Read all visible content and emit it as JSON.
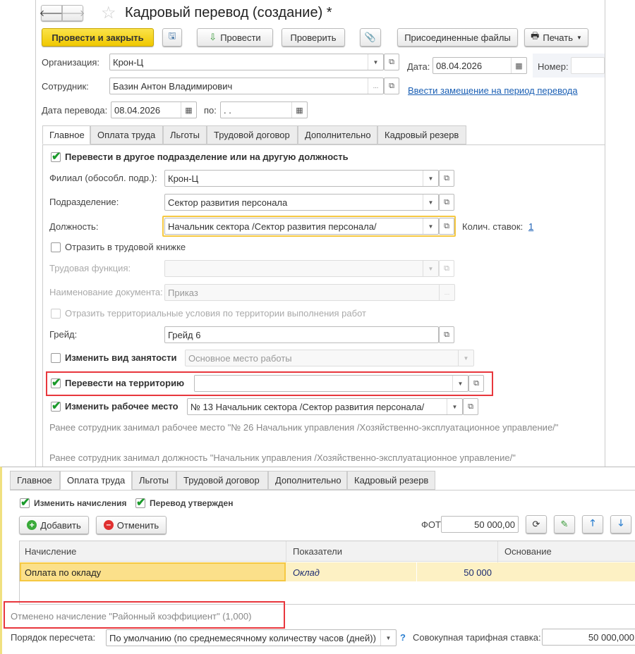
{
  "title": "Кадровый перевод (создание) *",
  "toolbar": {
    "post_close": "Провести и закрыть",
    "post": "Провести",
    "check": "Проверить",
    "files": "Присоединенные файлы",
    "print": "Печать"
  },
  "header": {
    "org_label": "Организация:",
    "org_value": "Крон-Ц",
    "date_label": "Дата:",
    "date_value": "08.04.2026",
    "number_label": "Номер:",
    "employee_label": "Сотрудник:",
    "employee_value": "Базин Антон Владимирович",
    "replacement_link": "Ввести замещение на период перевода",
    "transfer_date_label": "Дата перевода:",
    "transfer_date_value": "08.04.2026",
    "to_label": "по:",
    "to_value": " .  . "
  },
  "tabs": [
    "Главное",
    "Оплата труда",
    "Льготы",
    "Трудовой договор",
    "Дополнительно",
    "Кадровый резерв"
  ],
  "main": {
    "transfer_cb": "Перевести в другое подразделение или на другую должность",
    "branch_label": "Филиал (обособл. подр.):",
    "branch_value": "Крон-Ц",
    "dept_label": "Подразделение:",
    "dept_value": "Сектор развития персонала",
    "position_label": "Должность:",
    "position_value": "Начальник сектора /Сектор развития персонала/",
    "rates_label": "Колич. ставок:",
    "rates_value": "1",
    "workbook_cb": "Отразить в трудовой книжке",
    "labor_func_label": "Трудовая функция:",
    "doc_name_label": "Наименование документа:",
    "doc_name_value": "Приказ",
    "territorial_cb": "Отразить территориальные условия по территории выполнения работ",
    "grade_label": "Грейд:",
    "grade_value": "Грейд 6",
    "employment_cb": "Изменить вид занятости",
    "employment_value": "Основное место работы",
    "territory_cb": "Перевести на территорию",
    "workplace_cb": "Изменить рабочее место",
    "workplace_value": "№ 13 Начальник сектора /Сектор развития персонала/",
    "prev_workplace": "Ранее сотрудник занимал рабочее место \"№ 26 Начальник управления /Хозяйственно-эксплуатационное управление/\"",
    "prev_position": "Ранее сотрудник занимал должность \"Начальник управления /Хозяйственно-эксплуатационное управление/\""
  },
  "pay": {
    "change_cb": "Изменить начисления",
    "approved_cb": "Перевод утвержден",
    "add": "Добавить",
    "cancel": "Отменить",
    "fot_label": "ФОТ:",
    "fot_value": "50 000,00",
    "columns": [
      "Начисление",
      "Показатели",
      "Основание"
    ],
    "row": {
      "accrual": "Оплата по окладу",
      "indicator": "Оклад",
      "value": "50 000"
    },
    "cancelled_note": "Отменено начисление \"Районный коэффициент\" (1,000)",
    "recalc_label": "Порядок пересчета:",
    "recalc_value": "По умолчанию (по среднемесячному количеству часов (дней))",
    "help": "?",
    "rate_label": "Совокупная тарифная ставка:",
    "rate_value": "50 000,000"
  },
  "colors": {
    "accent": "#f5d21a",
    "highlight": "#e8373d",
    "selected_row": "#fdf1c4"
  }
}
